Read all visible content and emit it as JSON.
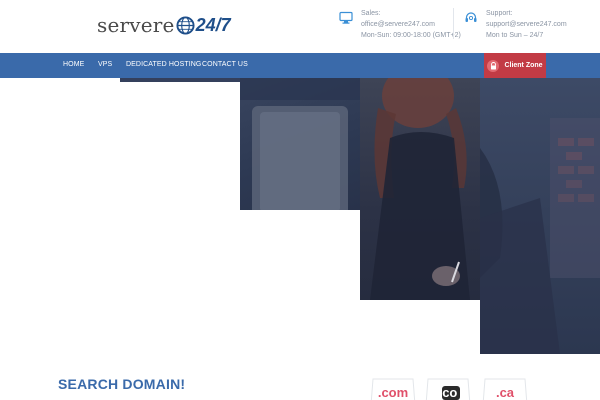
{
  "header": {
    "logo": {
      "word": "servere",
      "number": "24/7"
    },
    "sales": {
      "label": "Sales:",
      "email": "office@servere247.com",
      "hours": "Mon-Sun: 09:00-18:00 (GMT+2)"
    },
    "support": {
      "label": "Support:",
      "email": "support@servere247.com",
      "hours": "Mon to Sun – 24/7"
    }
  },
  "nav": {
    "items": [
      "HOME",
      "VPS",
      "DEDICATED HOSTING",
      "CONTACT US"
    ],
    "client_zone": "Client Zone"
  },
  "domain": {
    "title": "SEARCH DOMAIN!",
    "tlds": [
      ".com",
      ".co",
      ".ca"
    ]
  },
  "colors": {
    "brand_blue": "#3a6aaa",
    "accent_red": "#c23b45",
    "tld_pink": "#e0506a"
  }
}
